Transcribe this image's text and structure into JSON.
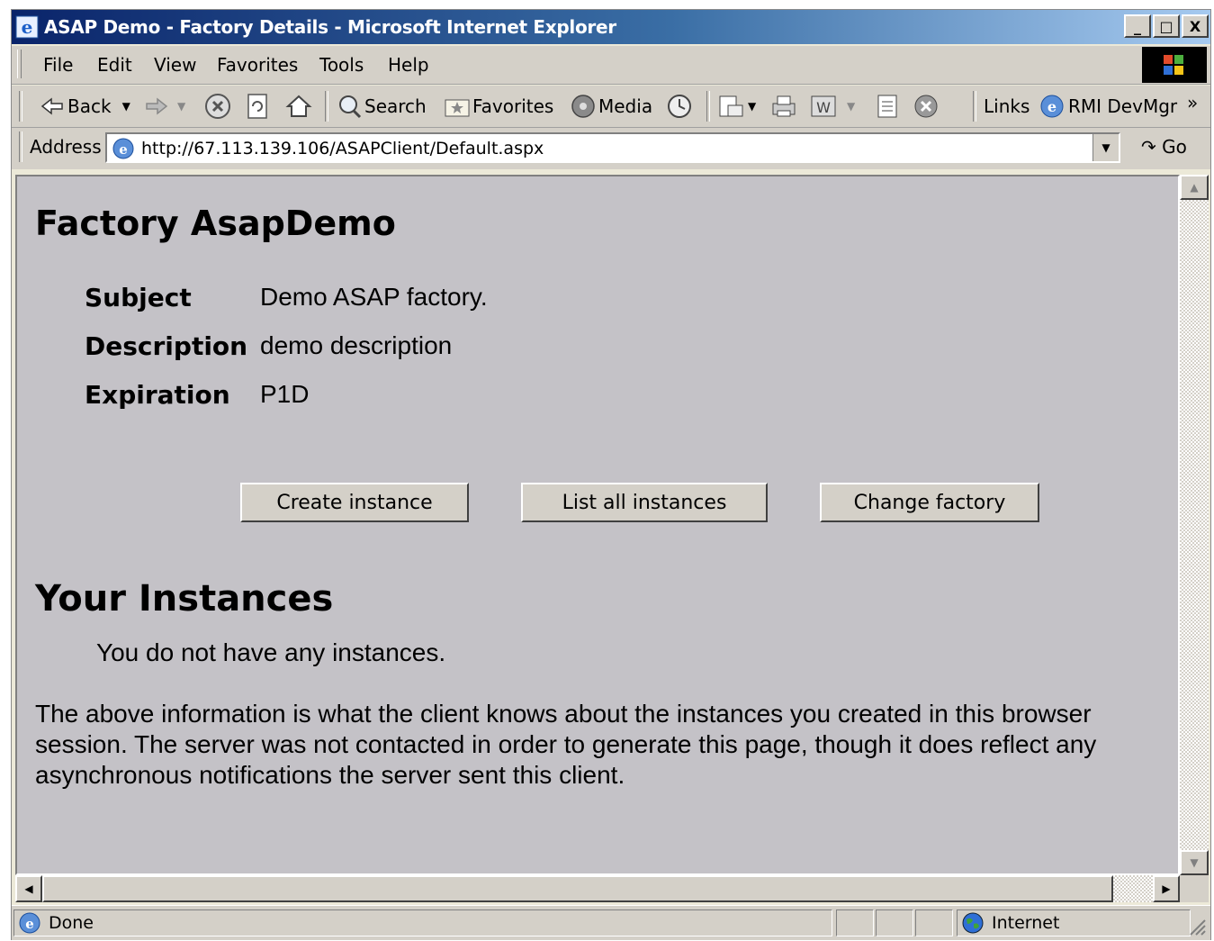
{
  "window": {
    "title": "ASAP Demo - Factory Details - Microsoft Internet Explorer",
    "minimize": "_",
    "maximize": "□",
    "close": "X"
  },
  "menu": {
    "items": [
      "File",
      "Edit",
      "View",
      "Favorites",
      "Tools",
      "Help"
    ]
  },
  "toolbar": {
    "back": "Back",
    "search": "Search",
    "favorites": "Favorites",
    "media": "Media",
    "links": "Links",
    "rmi": "RMI DevMgr",
    "more": "»"
  },
  "address": {
    "label": "Address",
    "url": "http://67.113.139.106/ASAPClient/Default.aspx",
    "go": "Go"
  },
  "page": {
    "factory_heading": "Factory AsapDemo",
    "details": [
      {
        "label": "Subject",
        "value": "Demo ASAP factory."
      },
      {
        "label": "Description",
        "value": "demo description"
      },
      {
        "label": "Expiration",
        "value": "P1D"
      }
    ],
    "buttons": {
      "create": "Create instance",
      "list": "List all instances",
      "change": "Change factory"
    },
    "instances_heading": "Your Instances",
    "no_instances": "You do not have any instances.",
    "info_line1": "The above information is what the client knows about the instances you created in this browser",
    "info_line2": "session. The server was not contacted in order to generate this page, though it does reflect any",
    "info_line3": "asynchronous notifications the server sent this client."
  },
  "status": {
    "text": "Done",
    "zone": "Internet"
  }
}
